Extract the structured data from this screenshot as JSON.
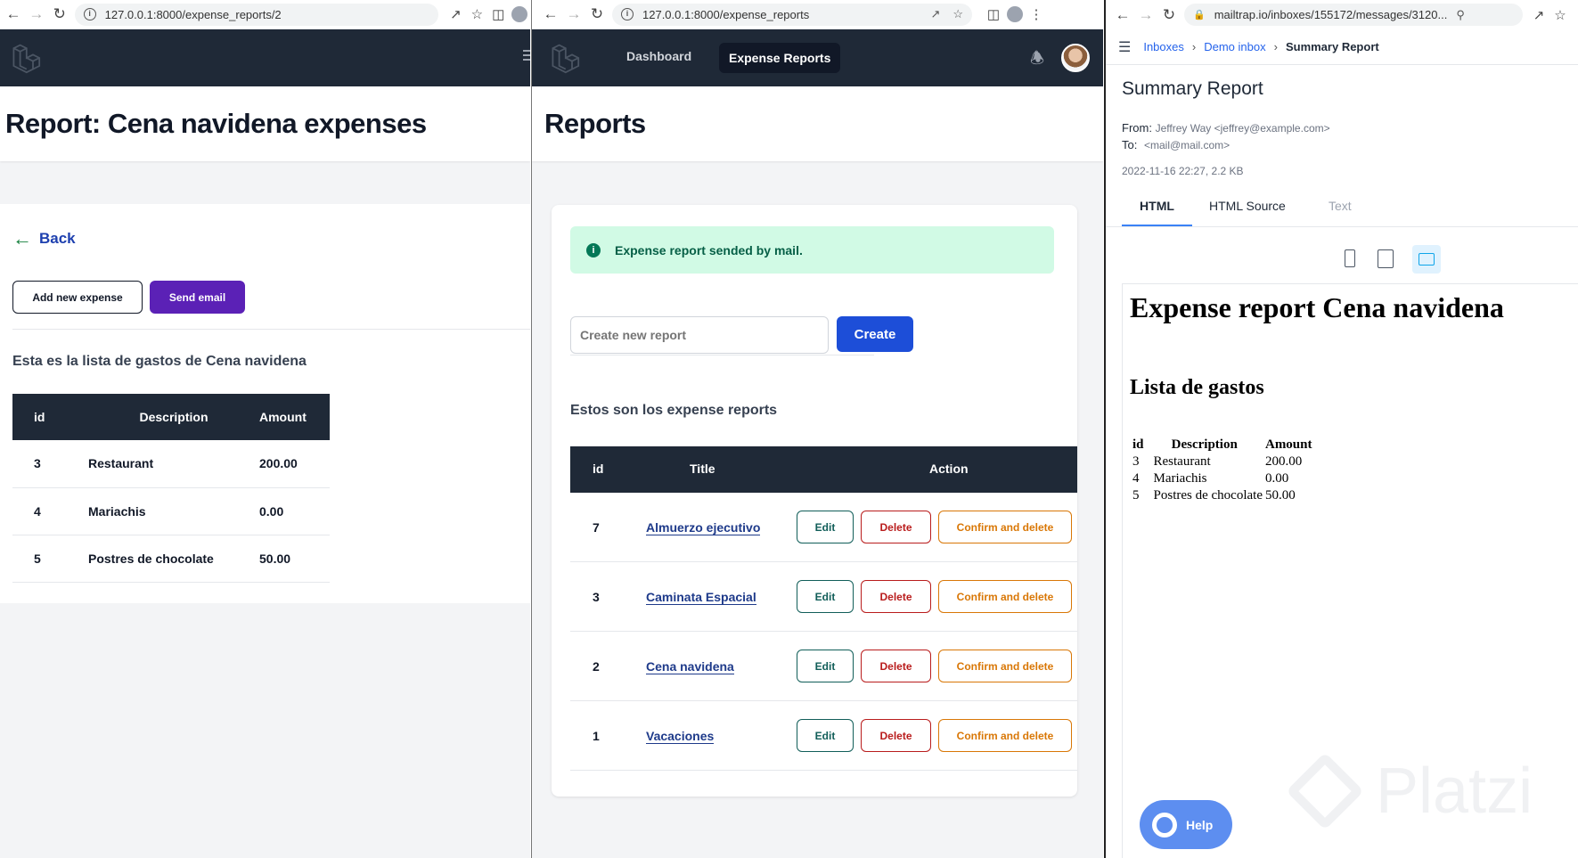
{
  "left": {
    "url": "127.0.0.1:8000/expense_reports/2",
    "page_title": "Report: Cena navidena expenses",
    "back_label": "Back",
    "add_button": "Add new expense",
    "send_button": "Send email",
    "list_heading": "Esta es la lista de gastos de Cena navidena",
    "columns": [
      "id",
      "Description",
      "Amount"
    ],
    "rows": [
      {
        "id": "3",
        "description": "Restaurant",
        "amount": "200.00"
      },
      {
        "id": "4",
        "description": "Mariachis",
        "amount": "0.00"
      },
      {
        "id": "5",
        "description": "Postres de chocolate",
        "amount": "50.00"
      }
    ]
  },
  "middle": {
    "url": "127.0.0.1:8000/expense_reports",
    "nav": {
      "dashboard": "Dashboard",
      "expense_reports": "Expense Reports"
    },
    "page_title": "Reports",
    "alert": "Expense report sended by mail.",
    "create_placeholder": "Create new report",
    "create_button": "Create",
    "list_heading": "Estos son los expense reports",
    "columns": [
      "id",
      "Title",
      "Action"
    ],
    "actions": {
      "edit": "Edit",
      "delete": "Delete",
      "confirm": "Confirm and delete"
    },
    "rows": [
      {
        "id": "7",
        "title": "Almuerzo ejecutivo"
      },
      {
        "id": "3",
        "title": "Caminata Espacial"
      },
      {
        "id": "2",
        "title": "Cena navidena"
      },
      {
        "id": "1",
        "title": "Vacaciones"
      }
    ]
  },
  "right": {
    "url": "mailtrap.io/inboxes/155172/messages/3120...",
    "breadcrumb": {
      "inboxes": "Inboxes",
      "demo": "Demo inbox",
      "current": "Summary Report"
    },
    "subject": "Summary Report",
    "from_label": "From:",
    "from": "Jeffrey Way <jeffrey@example.com>",
    "to_label": "To:",
    "to": "<mail@mail.com>",
    "meta": "2022-11-16 22:27, 2.2 KB",
    "tabs": [
      "HTML",
      "HTML Source",
      "Text"
    ],
    "mail_title": "Expense report Cena navidena",
    "mail_subtitle": "Lista de gastos",
    "mail_columns": [
      "id",
      "Description",
      "Amount"
    ],
    "mail_rows": [
      {
        "id": "3",
        "description": "Restaurant",
        "amount": "200.00"
      },
      {
        "id": "4",
        "description": "Mariachis",
        "amount": "0.00"
      },
      {
        "id": "5",
        "description": "Postres de chocolate",
        "amount": "50.00"
      }
    ],
    "help_button": "Help",
    "watermark": "Platzi"
  },
  "colors": {
    "nav_dark": "#1f2937",
    "purple": "#5b21b6",
    "blue": "#1d4ed8",
    "alert_bg": "#d1fae5",
    "alert_text": "#065f46",
    "delete_red": "#b91c1c",
    "confirm_orange": "#d97706",
    "tab_blue": "#3b82f6",
    "help_blue": "#5d8ef0"
  }
}
